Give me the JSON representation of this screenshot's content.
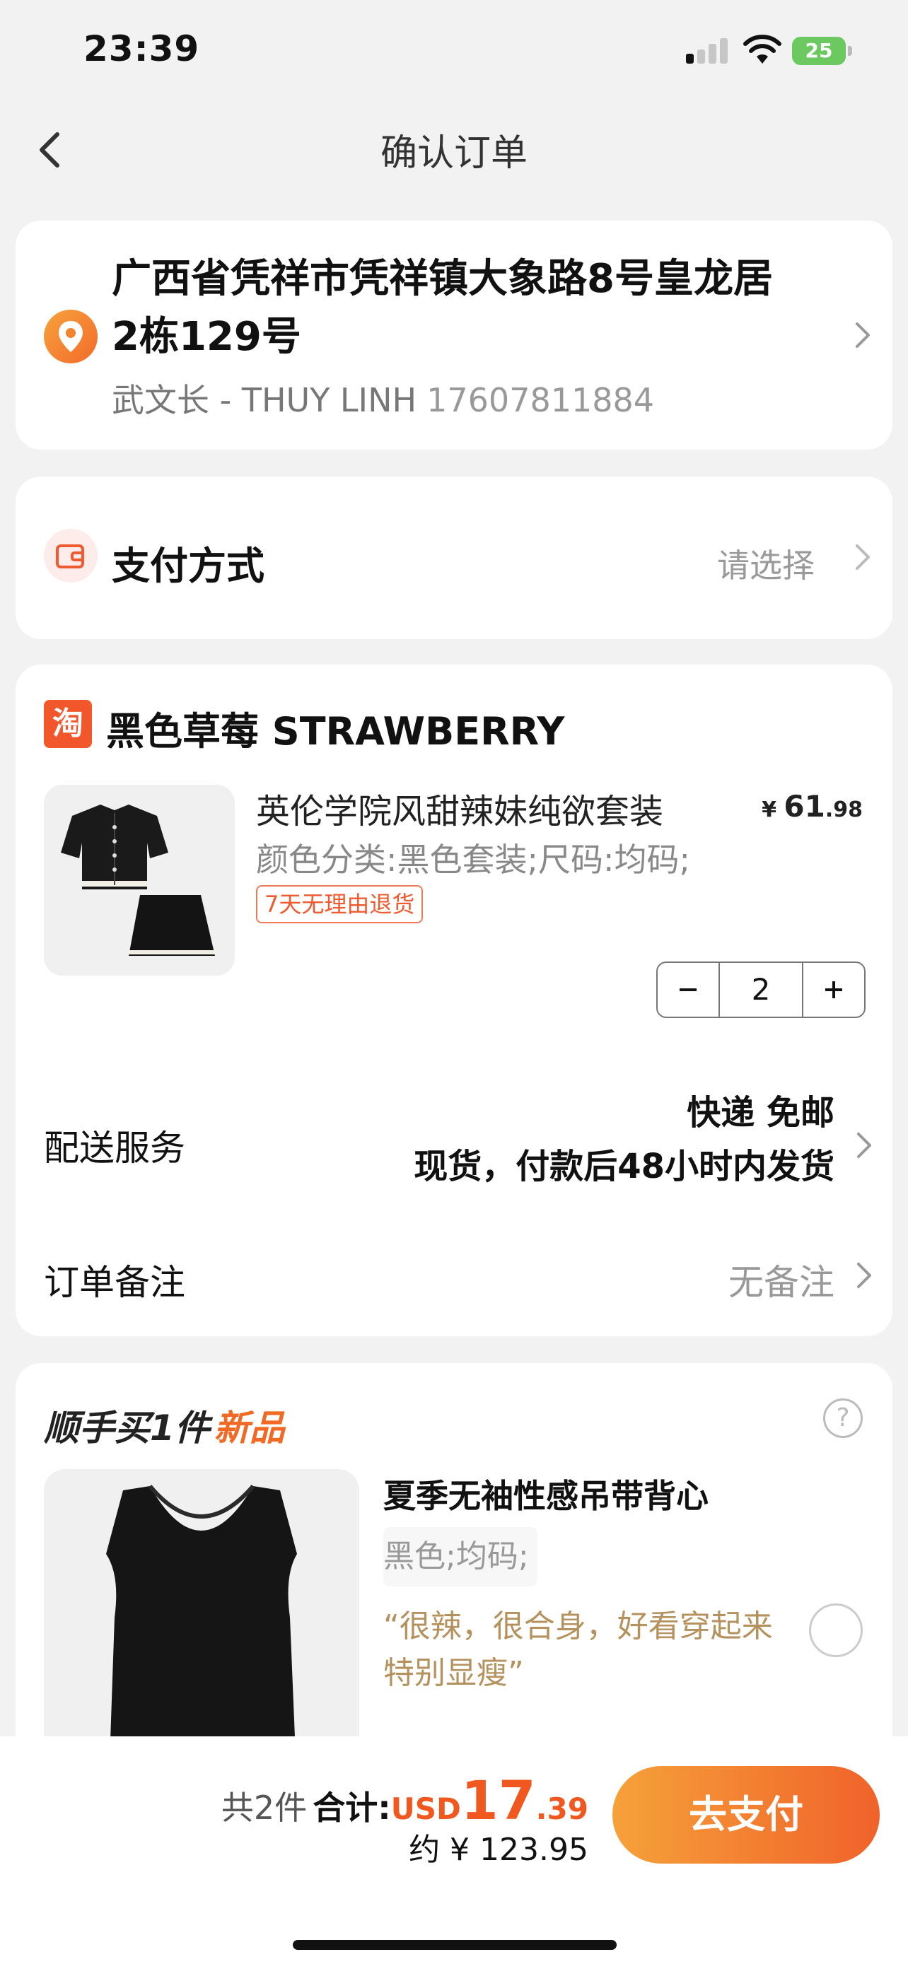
{
  "status_bar": {
    "time": "23:39",
    "battery": "25"
  },
  "nav": {
    "title": "确认订单"
  },
  "address": {
    "full": "广西省凭祥市凭祥镇大象路8号皇龙居2栋129号",
    "contact": "武文长 - THUY LINH",
    "phone": "17607811884"
  },
  "payment": {
    "label": "支付方式",
    "value": "请选择"
  },
  "shop": {
    "logo_char": "淘",
    "name": "黑色草莓  STRAWBERRY"
  },
  "product": {
    "title": "英伦学院风甜辣妹纯欲套装",
    "price_symbol": "¥ ",
    "price_int": "61",
    "price_dec": ".98",
    "spec": "颜色分类:黑色套装;尺码:均码;",
    "return_tag": "7天无理由退货",
    "quantity": "2",
    "minus": "−",
    "plus": "+"
  },
  "delivery": {
    "label": "配送服务",
    "type": "快递 免邮",
    "time": "现货，付款后48小时内发货"
  },
  "note": {
    "label": "订单备注",
    "value": "无备注"
  },
  "recommend": {
    "heading": "顺手买1件",
    "heading_accent": "新品",
    "help": "?",
    "title": "夏季无袖性感吊带背心",
    "spec": "黑色;均码;",
    "review": "“很辣，很合身，好看穿起来特别显瘦”"
  },
  "footer": {
    "count": "共2件",
    "total_label": "合计:",
    "currency": "USD",
    "amount_int": "17",
    "amount_dec": ".39",
    "approx": "约 ¥ 123.95",
    "pay_button": "去支付"
  },
  "colors": {
    "accent": "#f0581f",
    "button_start": "#f6a13a",
    "button_end": "#f0622a",
    "battery": "#6cc960"
  }
}
